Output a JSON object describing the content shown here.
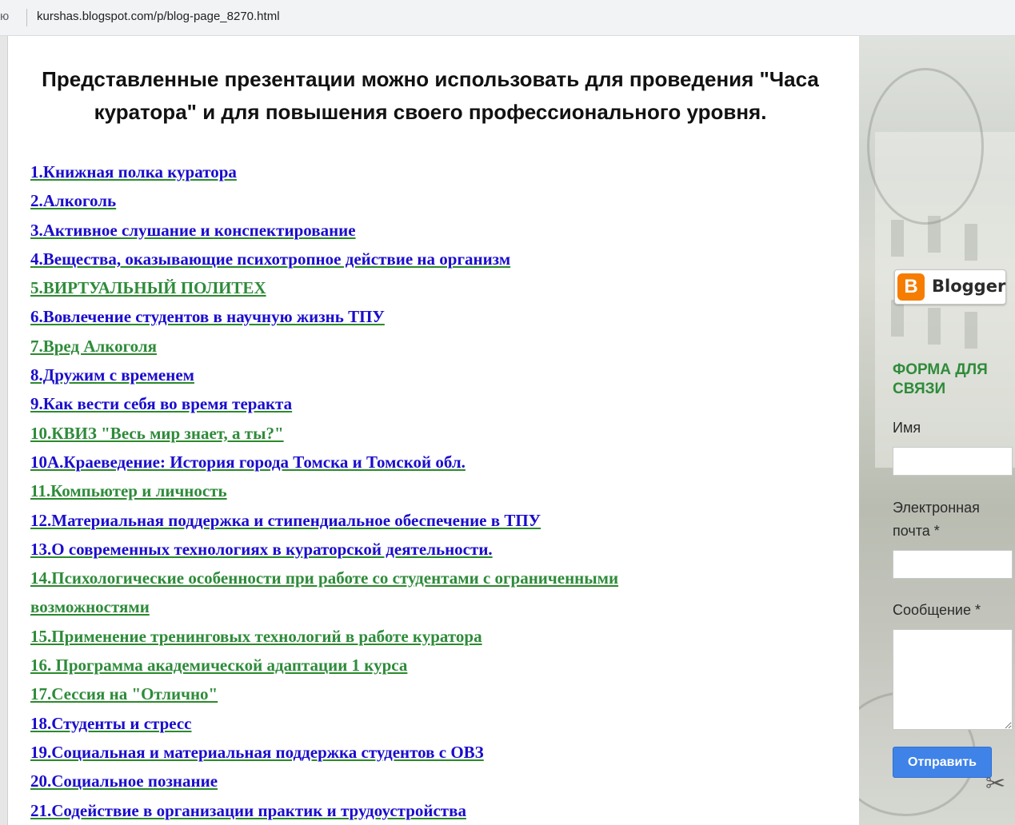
{
  "browser": {
    "address_prefix": "ю",
    "url": "kurshas.blogspot.com/p/blog-page_8270.html"
  },
  "main": {
    "heading": "Представленные презентации можно использовать для проведения \"Часа куратора\" и для повышения своего профессионального уровня.",
    "links": [
      {
        "label": "1.Книжная полка куратора ",
        "color": "#1a0dcc"
      },
      {
        "label": "2.Алкоголь",
        "color": "#1a0dcc"
      },
      {
        "label": "3.Активное слушание и конспектирование",
        "color": "#1a0dcc"
      },
      {
        "label": "4.Вещества, оказывающие психотропное действие на организм",
        "color": "#1a0dcc"
      },
      {
        "label": "5.ВИРТУАЛЬНЫЙ ПОЛИТЕХ",
        "color": "#2e8b3a"
      },
      {
        "label": "6.Вовлечение студентов в научную жизнь ТПУ",
        "color": "#1a0dcc"
      },
      {
        "label": "7.Вред Алкоголя",
        "color": "#2e8b3a"
      },
      {
        "label": "8.Дружим с временем",
        "color": "#1a0dcc"
      },
      {
        "label": "9.Как вести себя во время теракта",
        "color": "#1a0dcc"
      },
      {
        "label": "10.КВИЗ \"Весь мир знает, а ты?\"",
        "color": "#2e8b3a"
      },
      {
        "label": "10А.Краеведение: История города Томска и Томской обл. ",
        "color": "#1a0dcc"
      },
      {
        "label": "11.Компьютер и личность",
        "color": "#2e8b3a"
      },
      {
        "label": "12.Материальная поддержка и стипендиальное обеспечение в ТПУ",
        "color": "#1a0dcc"
      },
      {
        "label": "13.О современных технологиях в кураторской деятельности. ",
        "color": "#1a0dcc"
      },
      {
        "label": "14.Психологические особенности при работе со студентами с ограниченными ",
        "color": "#2e8b3a"
      },
      {
        "label": "возможностями ",
        "color": "#2e8b3a"
      },
      {
        "label": "15.Применение тренинговых технологий в работе куратора",
        "color": "#2e8b3a"
      },
      {
        "label": "16. Программа академической адаптации 1 курса",
        "color": "#2e8b3a"
      },
      {
        "label": "17.Сессия на \"Отлично\"",
        "color": "#2e8b3a"
      },
      {
        "label": "18.Студенты и стресс",
        "color": "#1a0dcc"
      },
      {
        "label": "19.Социальная и материальная поддержка студентов с ОВЗ",
        "color": "#1a0dcc"
      },
      {
        "label": "20.Социальное познание",
        "color": "#1a0dcc"
      },
      {
        "label": "21.Содействие в организации практик и трудоустройства",
        "color": "#1a0dcc"
      }
    ]
  },
  "sidebar": {
    "blogger_badge": "Blogger",
    "blogger_icon": "blogger-logo-icon",
    "contact_form": {
      "title": "ФОРМА ДЛЯ СВЯЗИ",
      "name_label": "Имя",
      "name_value": "",
      "email_label": "Электронная почта *",
      "email_value": "",
      "message_label": "Сообщение *",
      "message_value": "",
      "submit_label": "Отправить"
    },
    "tools_icon": "tools-icon"
  },
  "colors": {
    "link_blue": "#1a0dcc",
    "link_green": "#2e8b3a",
    "form_title": "#2e8b3a",
    "submit_button": "#3f83e8",
    "blogger_orange": "#f57d00"
  }
}
